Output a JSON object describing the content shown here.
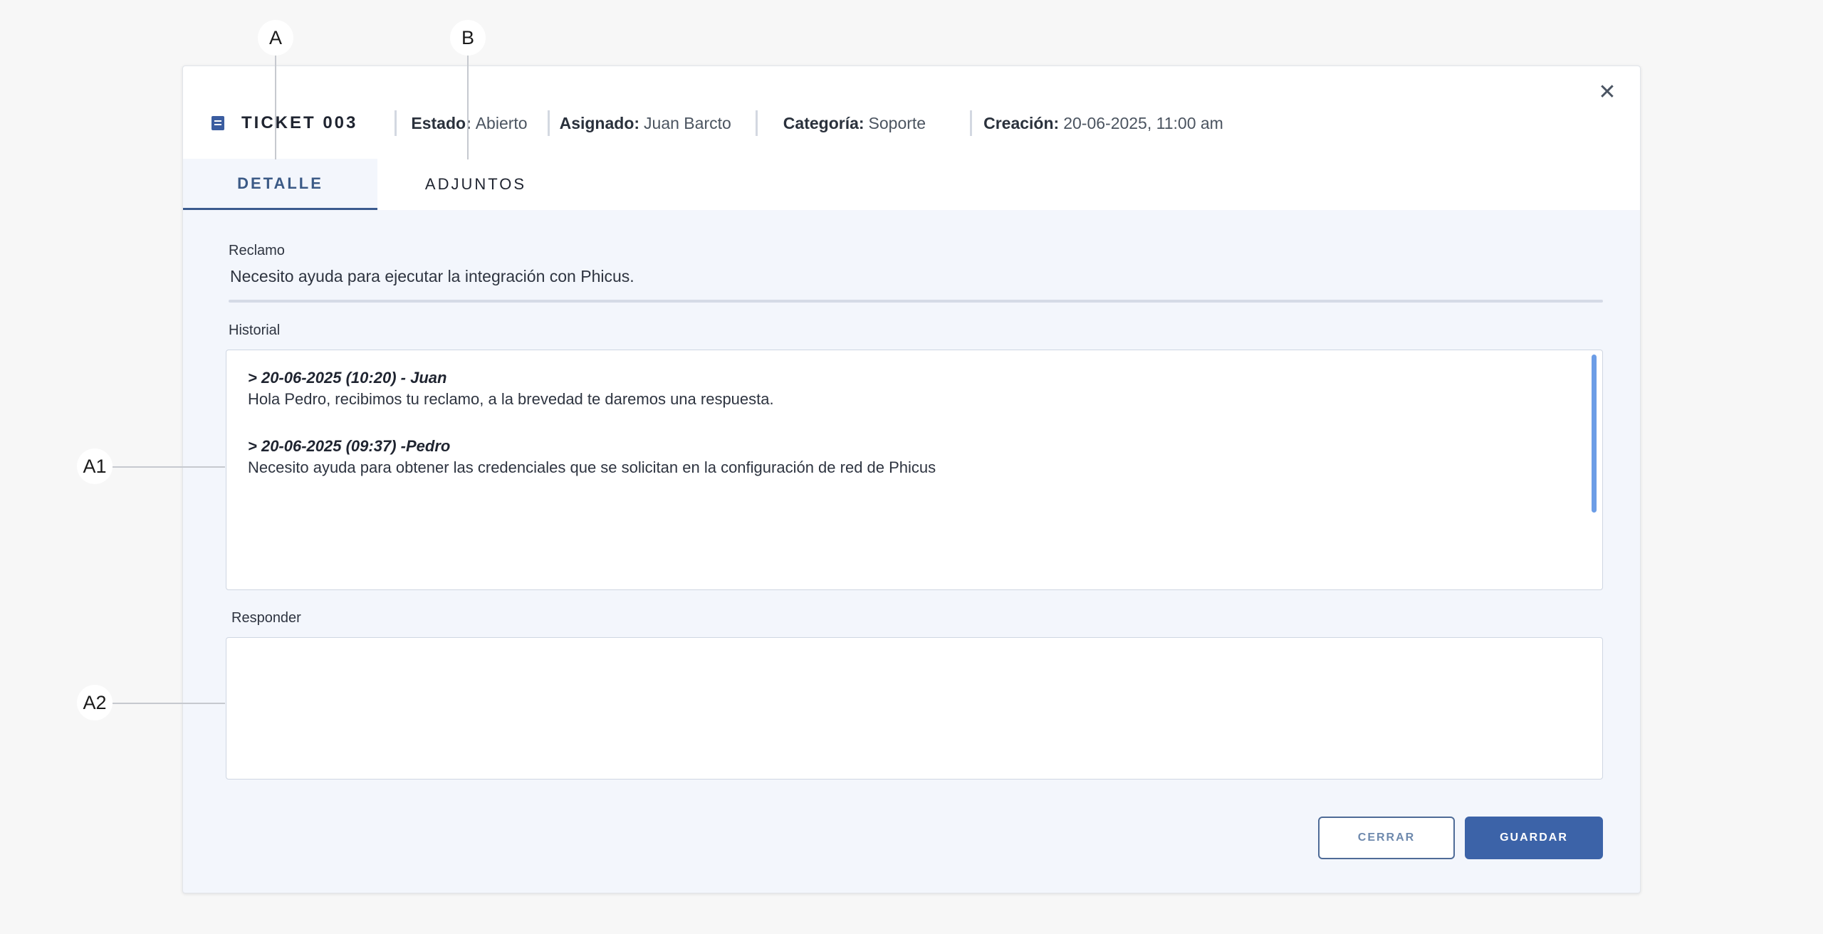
{
  "callouts": {
    "a": "A",
    "b": "B",
    "a1": "A1",
    "a2": "A2"
  },
  "ticket": {
    "title": "TICKET 003",
    "close_icon": "close-icon",
    "meta": {
      "estado_label": "Estado:",
      "estado_value": "Abierto",
      "asignado_label": "Asignado:",
      "asignado_value": "Juan Barcto",
      "categoria_label": "Categoría:",
      "categoria_value": "Soporte",
      "creacion_label": "Creación:",
      "creacion_value": "20-06-2025, 11:00 am"
    }
  },
  "tabs": [
    {
      "label": "DETALLE",
      "active": true
    },
    {
      "label": "ADJUNTOS",
      "active": false
    }
  ],
  "reclamo": {
    "label": "Reclamo",
    "text": "Necesito ayuda para ejecutar la integración con Phicus."
  },
  "historial": {
    "label": "Historial",
    "entries": [
      {
        "header": "> 20-06-2025 (10:20) - Juan",
        "body": "Hola Pedro, recibimos tu reclamo, a la brevedad te daremos una respuesta."
      },
      {
        "header": "> 20-06-2025 (09:37) -Pedro",
        "body": "Necesito ayuda para obtener las credenciales que se solicitan en la configuración de red de Phicus"
      }
    ]
  },
  "responder": {
    "label": "Responder",
    "value": ""
  },
  "buttons": {
    "cerrar": "CERRAR",
    "guardar": "GUARDAR"
  },
  "colors": {
    "accent": "#3c63a8",
    "background": "#f7f7f7",
    "panel": "#f3f6fc",
    "scrollbar": "#6c9de6"
  }
}
